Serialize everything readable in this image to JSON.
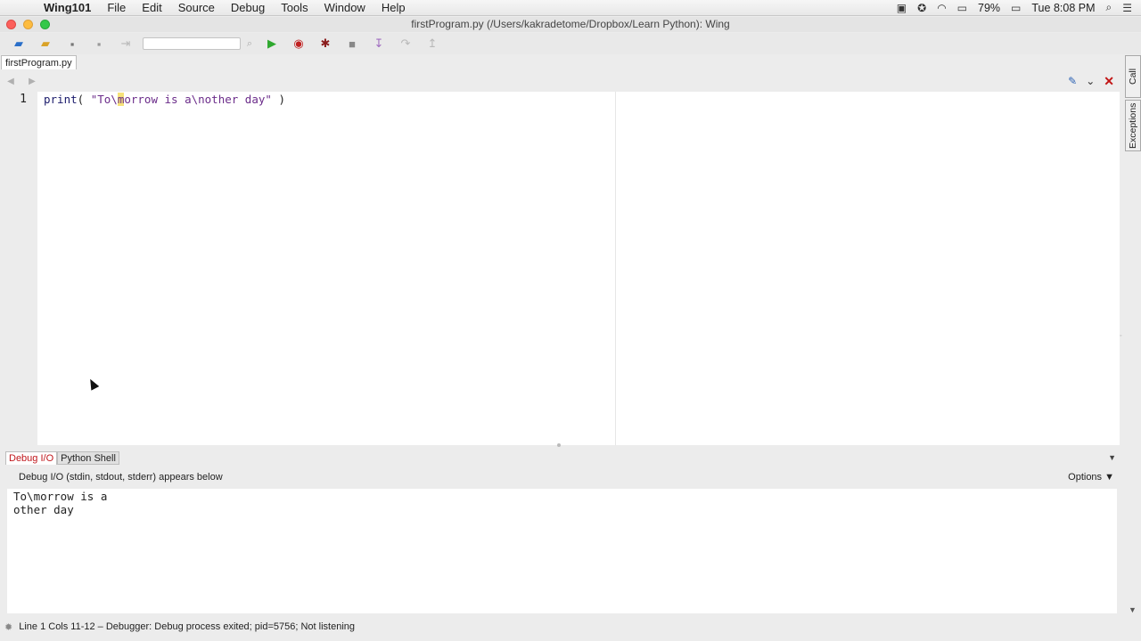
{
  "menubar": {
    "app_name": "Wing101",
    "items": [
      "File",
      "Edit",
      "Source",
      "Debug",
      "Tools",
      "Window",
      "Help"
    ],
    "battery": "79%",
    "clock": "Tue 8:08 PM"
  },
  "window": {
    "title": "firstProgram.py (/Users/kakradetome/Dropbox/Learn Python): Wing"
  },
  "toolbar": {
    "search_value": ""
  },
  "editor": {
    "tab_label": "firstProgram.py",
    "line_number": "1",
    "code_kw": "print",
    "code_open": "( ",
    "code_str_a": "\"To\\",
    "code_cursor_char": "m",
    "code_str_b": "orrow is a\\nother day\"",
    "code_close": " )"
  },
  "side_tabs": {
    "call_stack": "Call Stack",
    "exceptions": "Exceptions"
  },
  "bottom_panel": {
    "tabs": [
      "Debug I/O",
      "Python Shell"
    ],
    "io_header": "Debug I/O (stdin, stdout, stderr) appears below",
    "options_label": "Options ▼",
    "output_lines": [
      "To\\morrow is a",
      "other day"
    ]
  },
  "statusbar": {
    "text": "Line 1 Cols 11-12 – Debugger: Debug process exited; pid=5756; Not listening"
  },
  "colors": {
    "active_tab_text": "#c0161b",
    "run_button": "#2ea82e",
    "close_icon": "#c21616"
  }
}
